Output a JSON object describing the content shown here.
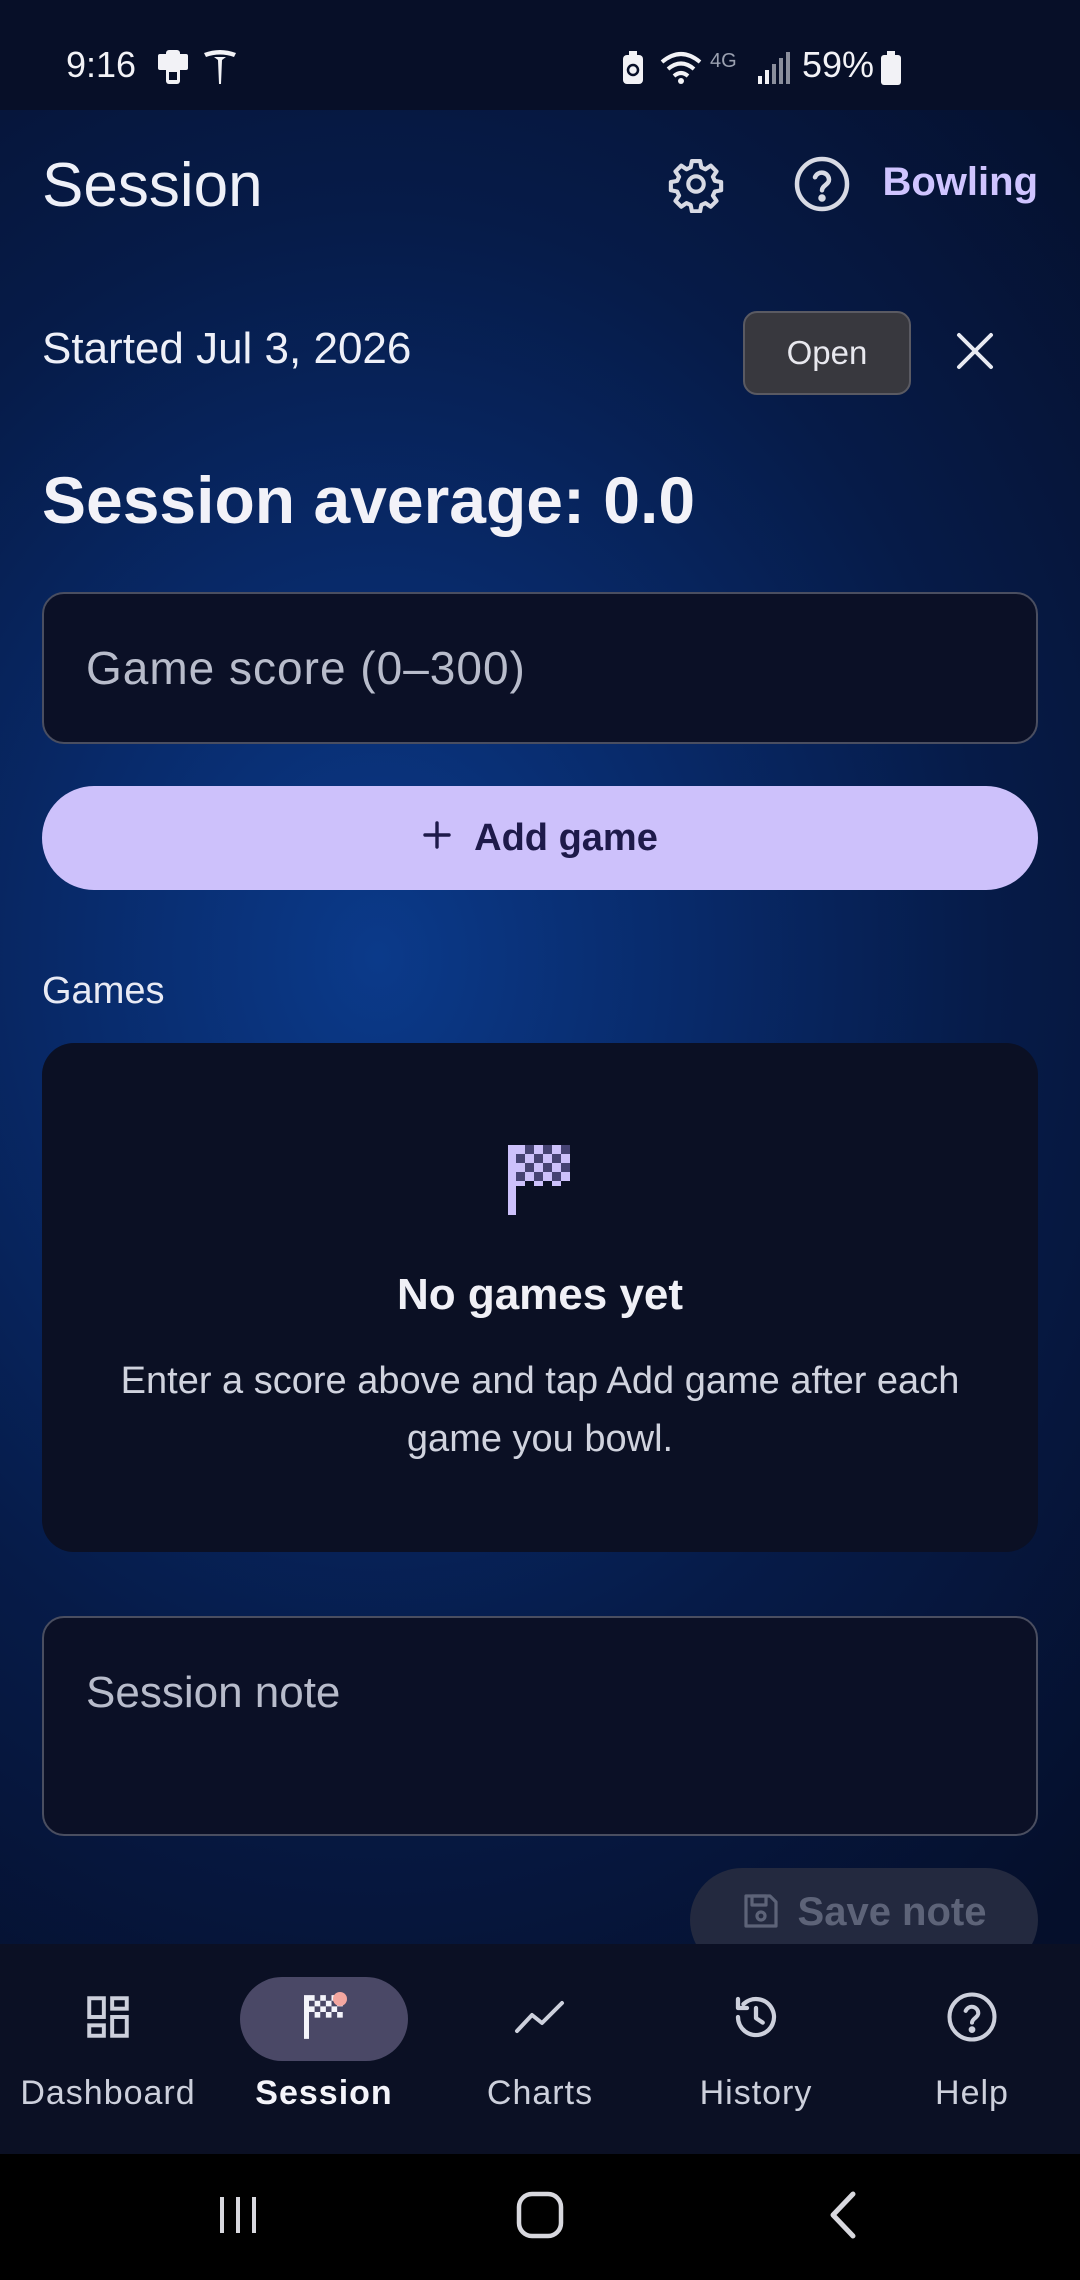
{
  "status_bar": {
    "time": "9:16",
    "battery_percent": "59%",
    "network_label": "4G"
  },
  "header": {
    "title": "Session",
    "brand": "Bowling",
    "settings_icon": "gear-icon",
    "help_icon": "help-circle-icon"
  },
  "session": {
    "started_text": "Started Jul 3, 2026",
    "status_chip": "Open",
    "average_text": "Session average: 0.0"
  },
  "score_input": {
    "placeholder": "Game score (0–300)",
    "value": ""
  },
  "add_game": {
    "label": "Add game"
  },
  "games": {
    "heading": "Games",
    "empty_title": "No games yet",
    "empty_description": "Enter a score above and tap Add game after each game you bowl."
  },
  "note": {
    "placeholder": "Session note",
    "value": "",
    "save_label": "Save note"
  },
  "bottom_nav": {
    "items": [
      {
        "label": "Dashboard",
        "icon": "dashboard-icon",
        "active": false
      },
      {
        "label": "Session",
        "icon": "checkered-flag-icon",
        "active": true
      },
      {
        "label": "Charts",
        "icon": "trend-line-icon",
        "active": false
      },
      {
        "label": "History",
        "icon": "history-icon",
        "active": false
      },
      {
        "label": "Help",
        "icon": "help-circle-icon",
        "active": false
      }
    ]
  },
  "colors": {
    "accent": "#cdc1fb",
    "brand_text": "#cfc4ff",
    "background_dark": "#050f2b",
    "background_glow": "#0b3a8a",
    "card": "#0b1024",
    "badge": "#f4a7a0"
  }
}
